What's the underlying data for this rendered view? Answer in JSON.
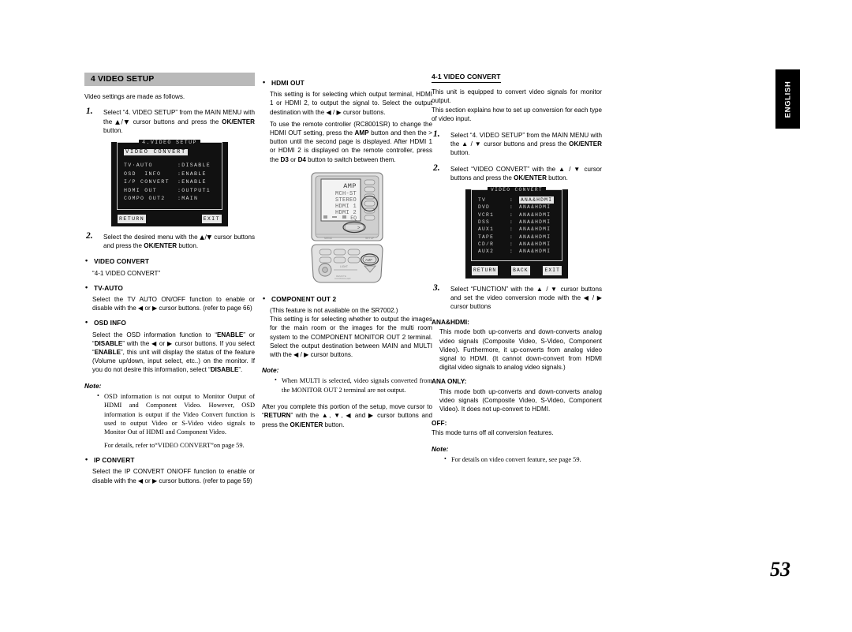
{
  "document": {
    "page_number": "53",
    "language_tab": "ENGLISH"
  },
  "left_column": {
    "section_bar": "4  VIDEO SETUP",
    "intro": "Video settings are made as follows.",
    "step1": {
      "num": "1.",
      "text_parts": {
        "a": "Select “4. VIDEO SETUP” from the MAIN MENU with the ",
        "cursor": "▲/▼",
        "b": " cursor buttons and press the ",
        "bold": "OK/ENTER",
        "c": " button."
      }
    },
    "osd_video_setup": {
      "title": "4.VIDEO SETUP",
      "highlight": "VIDEO CONVERT",
      "rows": [
        {
          "label": "TV·AUTO",
          "value": ":DISABLE"
        },
        {
          "label": "OSD  INFO",
          "value": ":ENABLE"
        },
        {
          "label": "I/P CONVERT",
          "value": ":ENABLE"
        },
        {
          "label": "HDMI OUT",
          "value": ":OUTPUT1"
        },
        {
          "label": "COMPO OUT2",
          "value": ":MAIN"
        }
      ],
      "foot_left": "RETURN",
      "foot_right": "EXIT"
    },
    "step2": {
      "num": "2.",
      "text_parts": {
        "a": "Select the desired menu with the ",
        "cursor": "▲/▼",
        "b": " cursor buttons and press the ",
        "bold": "OK/ENTER",
        "c": " button."
      }
    },
    "items": [
      {
        "head": "VIDEO CONVERT",
        "body": "“4-1 VIDEO CONVERT”"
      },
      {
        "head": "TV-AUTO",
        "body": "Select the TV AUTO ON/OFF function to enable or disable with the ◀ or ▶ cursor buttons. (refer to page 66)"
      },
      {
        "head": "OSD INFO",
        "body_a": "Select the OSD information function to “",
        "b1": "ENABLE",
        "body_b": "” or “",
        "b2": "DISABLE",
        "body_c": "” with the ◀ or ▶ cursor buttons. If you select “",
        "b3": "ENABLE",
        "body_d": "”, this unit will display the status of the feature (Volume up/down, input select, etc..) on the monitor. If you do not desire this information, select “",
        "b4": "DISABLE",
        "body_e": "”."
      }
    ],
    "note": {
      "label": "Note:",
      "body": "OSD information is not output to Monitor Output of HDMI and Component Video. However, OSD information is output if the Video Convert function is used to output Video or S-Video video signals to Monitor Out of HDMI and Component Video.",
      "extra": "For details, refer to“VIDEO CONVERT”on page 59."
    },
    "ip_convert": {
      "head": "IP CONVERT",
      "body": "Select the IP CONVERT ON/OFF function to enable or disable with the ◀ or ▶ cursor buttons. (refer to page 59)"
    }
  },
  "middle_column": {
    "hdmi_out": {
      "head": "HDMI OUT",
      "para1_a": "This setting is for selecting which output terminal, HDMI 1 or HDMI 2, to output the signal to. Select the output destination with the ◀ / ▶ cursor buttons.",
      "para2_a": "To use the remote controller (RC8001SR) to change the HDMI OUT setting, press the ",
      "amp": "AMP",
      "para2_b": " button and then the > button until the second page is displayed. After HDMI 1 or HDMI 2 is displayed on the remote controller, press the ",
      "d3": "D3",
      "para2_c": " or ",
      "d4": "D4",
      "para2_d": " button to switch between them."
    },
    "remote_display": {
      "line1": "AMP",
      "line2": "MCH-ST",
      "line3": "STEREO",
      "line4": "HDMI 1",
      "line5": "HDMI 2",
      "line6": "EQ"
    },
    "component_out2": {
      "head": "COMPONENT OUT 2",
      "note_line": "(This feature is not available on the SR7002.)",
      "body": "This setting is for selecting whether to output the images for the main room or the images for the multi room system to the COMPONENT MONITOR OUT 2 terminal. Select the output destination between MAIN and MULTI with the ◀ / ▶ cursor buttons."
    },
    "note": {
      "label": "Note:",
      "body": "When MULTI is selected, video signals converted from the MONITOR OUT 2 terminal are not output."
    },
    "closing": {
      "a": "After you complete this portion of the setup, move cursor to “",
      "b1": "RETURN",
      "b": "” with the ▲, ▼, ◀ and ▶ cursor buttons and press the ",
      "b2": "OK/ENTER",
      "c": " button."
    }
  },
  "right_column": {
    "sub_head": "4-1  VIDEO CONVERT",
    "intro_1": "This unit is equipped to convert video signals for monitor output.",
    "intro_2": "This section explains how to set up conversion for each type of video input.",
    "step1": {
      "num": "1.",
      "a": "Select “4. VIDEO SETUP” from the MAIN MENU with the ▲ / ▼ cursor buttons and press the ",
      "bold": "OK/ENTER",
      "c": " button."
    },
    "step2": {
      "num": "2.",
      "a": "Select “VIDEO CONVERT” with the ▲ / ▼ cursor buttons and press the ",
      "bold": "OK/ENTER",
      "c": " button."
    },
    "osd_video_convert": {
      "title": "VIDEO CONVERT",
      "rows": [
        {
          "name": "TV",
          "colon": ":",
          "value": "ANA&HDMI",
          "highlight": true
        },
        {
          "name": "DVD",
          "colon": ":",
          "value": "ANA&HDMI",
          "highlight": false
        },
        {
          "name": "VCR1",
          "colon": ":",
          "value": "ANA&HDMI",
          "highlight": false
        },
        {
          "name": "DSS",
          "colon": ":",
          "value": "ANA&HDMI",
          "highlight": false
        },
        {
          "name": "AUX1",
          "colon": ":",
          "value": "ANA&HDMI",
          "highlight": false
        },
        {
          "name": "TAPE",
          "colon": ":",
          "value": "ANA&HDMI",
          "highlight": false
        },
        {
          "name": "CD/R",
          "colon": ":",
          "value": "ANA&HDMI",
          "highlight": false
        },
        {
          "name": "AUX2",
          "colon": ":",
          "value": "ANA&HDMI",
          "highlight": false
        }
      ],
      "foot_left": "RETURN",
      "foot_mid": "BACK",
      "foot_right": "EXIT"
    },
    "step3": {
      "num": "3.",
      "text": "Select “FUNCTION” with the ▲ / ▼ cursor buttons and set the video conversion mode with the ◀ / ▶ cursor buttons"
    },
    "modes": [
      {
        "head": "ANA&HDMI:",
        "body": "This mode both up-converts and down-converts analog video signals (Composite Video, S-Video, Component Video). Furthermore, it up-converts from analog video signal to HDMI. (It cannot down-convert from HDMI digital video signals to analog video signals.)"
      },
      {
        "head": "ANA ONLY:",
        "body": "This mode both up-converts and down-converts analog video signals (Composite Video, S-Video, Component Video). It does not up-convert to HDMI."
      },
      {
        "head": "OFF:",
        "body": "This mode turns off all conversion features."
      }
    ],
    "note": {
      "label": "Note:",
      "body": "For details on video convert feature, see page 59."
    }
  }
}
